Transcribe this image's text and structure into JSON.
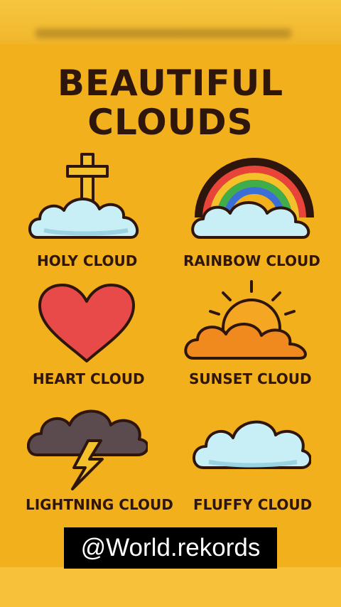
{
  "poster": {
    "title_line1": "BEAUTIFUL",
    "title_line2": "CLOUDS",
    "items": [
      {
        "label": "HOLY CLOUD",
        "icon": "holy-cloud-icon"
      },
      {
        "label": "RAINBOW CLOUD",
        "icon": "rainbow-cloud-icon"
      },
      {
        "label": "HEART CLOUD",
        "icon": "heart-cloud-icon"
      },
      {
        "label": "SUNSET CLOUD",
        "icon": "sunset-cloud-icon"
      },
      {
        "label": "LIGHTNING CLOUD",
        "icon": "lightning-cloud-icon"
      },
      {
        "label": "FLUFFY CLOUD",
        "icon": "fluffy-cloud-icon"
      }
    ]
  },
  "overlay": {
    "watermark": "@World.rekords"
  },
  "colors": {
    "background": "#f2b01c",
    "title_text": "#2e160c",
    "cloud_light": "#c8eef6",
    "heart": "#e84a4a",
    "sunset": "#f0891e",
    "storm": "#5b4a4e",
    "bolt": "#f5c12a"
  }
}
